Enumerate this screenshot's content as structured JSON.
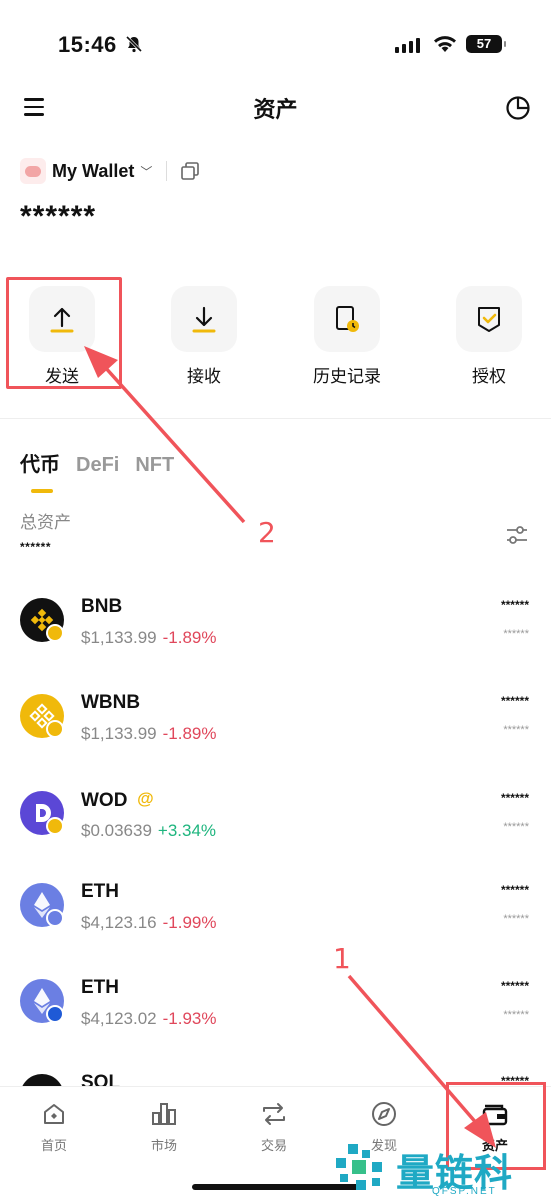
{
  "status_bar": {
    "time": "15:46",
    "battery": "57"
  },
  "header": {
    "title": "资产"
  },
  "wallet": {
    "name": "My Wallet",
    "chevron": "﹀",
    "balance": "******"
  },
  "actions": [
    {
      "label": "发送",
      "icon": "upload-arrow-icon"
    },
    {
      "label": "接收",
      "icon": "download-arrow-icon"
    },
    {
      "label": "历史记录",
      "icon": "history-doc-icon"
    },
    {
      "label": "授权",
      "icon": "authorize-shield-icon"
    }
  ],
  "tabs": [
    "代币",
    "DeFi",
    "NFT"
  ],
  "total": {
    "label": "总资产",
    "value": "******"
  },
  "tokens": [
    {
      "symbol": "BNB",
      "price": "$1,133.99",
      "change": "-1.89%",
      "amount": "******",
      "value": "******"
    },
    {
      "symbol": "WBNB",
      "price": "$1,133.99",
      "change": "-1.89%",
      "amount": "******",
      "value": "******"
    },
    {
      "symbol": "WOD",
      "badge": "@",
      "price": "$0.03639",
      "change": "+3.34%",
      "amount": "******",
      "value": "******"
    },
    {
      "symbol": "ETH",
      "price": "$4,123.16",
      "change": "-1.99%",
      "amount": "******",
      "value": "******"
    },
    {
      "symbol": "ETH",
      "price": "$4,123.02",
      "change": "-1.93%",
      "amount": "******",
      "value": "******"
    },
    {
      "symbol": "SOL",
      "amount": "******"
    }
  ],
  "bottom_nav": [
    {
      "label": "首页",
      "icon": "home-icon"
    },
    {
      "label": "市场",
      "icon": "bar-chart-icon"
    },
    {
      "label": "交易",
      "icon": "swap-icon"
    },
    {
      "label": "发现",
      "icon": "compass-icon"
    },
    {
      "label": "资产",
      "icon": "wallet-icon"
    }
  ],
  "annotations": {
    "label_1": "1",
    "label_2": "2"
  },
  "watermark": {
    "text": "量链科技",
    "sub": "QFSP.NET"
  },
  "colors": {
    "accent": "#f0b90b",
    "negative": "#e0475b",
    "positive": "#1eb57e",
    "annotation": "#f0545a"
  }
}
